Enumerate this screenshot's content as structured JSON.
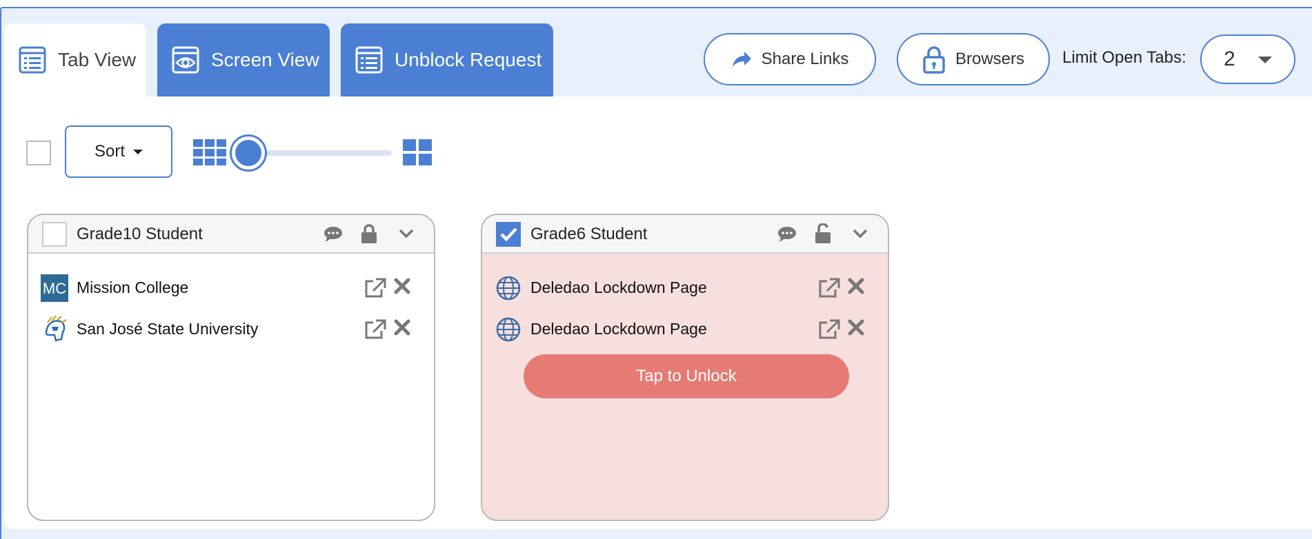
{
  "tabs": [
    {
      "label": "Tab View",
      "icon": "list-icon",
      "active": true
    },
    {
      "label": "Screen View",
      "icon": "eye-icon",
      "active": false
    },
    {
      "label": "Unblock Request",
      "icon": "list-icon",
      "active": false
    }
  ],
  "header": {
    "share_links_label": "Share Links",
    "browsers_label": "Browsers",
    "limit_label": "Limit Open Tabs:",
    "limit_value": "2"
  },
  "toolbar": {
    "sort_label": "Sort",
    "slider_level": 0.1
  },
  "cards": [
    {
      "title": "Grade10 Student",
      "checked": false,
      "locked": true,
      "tabs": [
        {
          "title": "Mission College",
          "icon": "mission-college-favicon"
        },
        {
          "title": "San José State University",
          "icon": "sjsu-spartan-favicon"
        }
      ]
    },
    {
      "title": "Grade6 Student",
      "checked": true,
      "locked": false,
      "unlock_label": "Tap to Unlock",
      "tabs": [
        {
          "title": "Deledao Lockdown Page",
          "icon": "globe-icon"
        },
        {
          "title": "Deledao Lockdown Page",
          "icon": "globe-icon"
        }
      ]
    }
  ],
  "colors": {
    "accent": "#4a7fd4",
    "locked_card_bg": "#f7dfde",
    "unlock_button": "#e57b74"
  }
}
